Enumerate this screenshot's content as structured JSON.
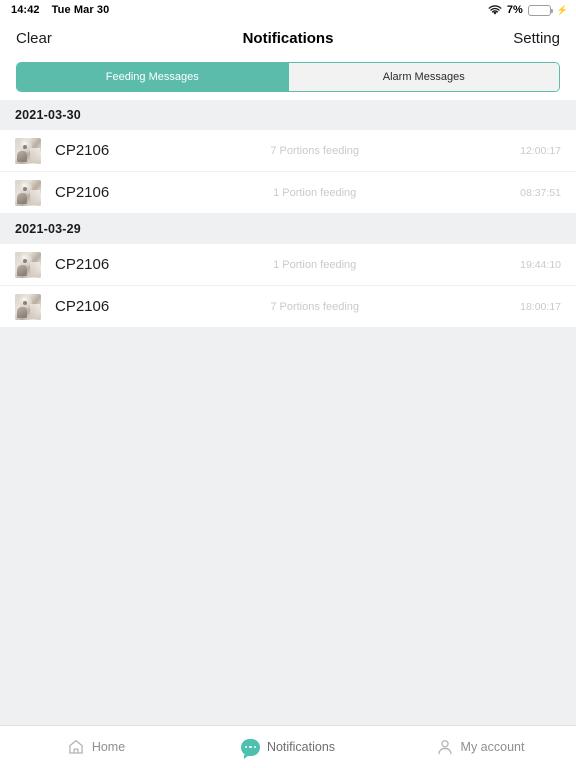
{
  "statusbar": {
    "time": "14:42",
    "date": "Tue Mar 30",
    "wifi_icon": "wifi-icon",
    "battery_percent": "7%",
    "battery_level": 7,
    "battery_color": "#f3403a",
    "charging_icon": "lightning-bolt-icon"
  },
  "navbar": {
    "left_label": "Clear",
    "title": "Notifications",
    "right_label": "Setting"
  },
  "segmented": {
    "active_color": "#5bbcab",
    "tabs": [
      {
        "label": "Feeding Messages",
        "active": true
      },
      {
        "label": "Alarm Messages",
        "active": false
      }
    ]
  },
  "groups": [
    {
      "date": "2021-03-30",
      "rows": [
        {
          "thumbnail": "pet-photo-thumbnail",
          "name": "CP2106",
          "description": "7 Portions feeding",
          "time": "12:00:17"
        },
        {
          "thumbnail": "pet-photo-thumbnail",
          "name": "CP2106",
          "description": "1 Portion feeding",
          "time": "08:37:51"
        }
      ]
    },
    {
      "date": "2021-03-29",
      "rows": [
        {
          "thumbnail": "pet-photo-thumbnail",
          "name": "CP2106",
          "description": "1 Portion feeding",
          "time": "19:44:10"
        },
        {
          "thumbnail": "pet-photo-thumbnail",
          "name": "CP2106",
          "description": "7 Portions feeding",
          "time": "18:00:17"
        }
      ]
    }
  ],
  "tabbar": {
    "active_color": "#4ec0b0",
    "items": [
      {
        "label": "Home",
        "icon": "home-icon",
        "active": false
      },
      {
        "label": "Notifications",
        "icon": "chat-bubble-icon",
        "active": true
      },
      {
        "label": "My account",
        "icon": "person-icon",
        "active": false
      }
    ]
  }
}
